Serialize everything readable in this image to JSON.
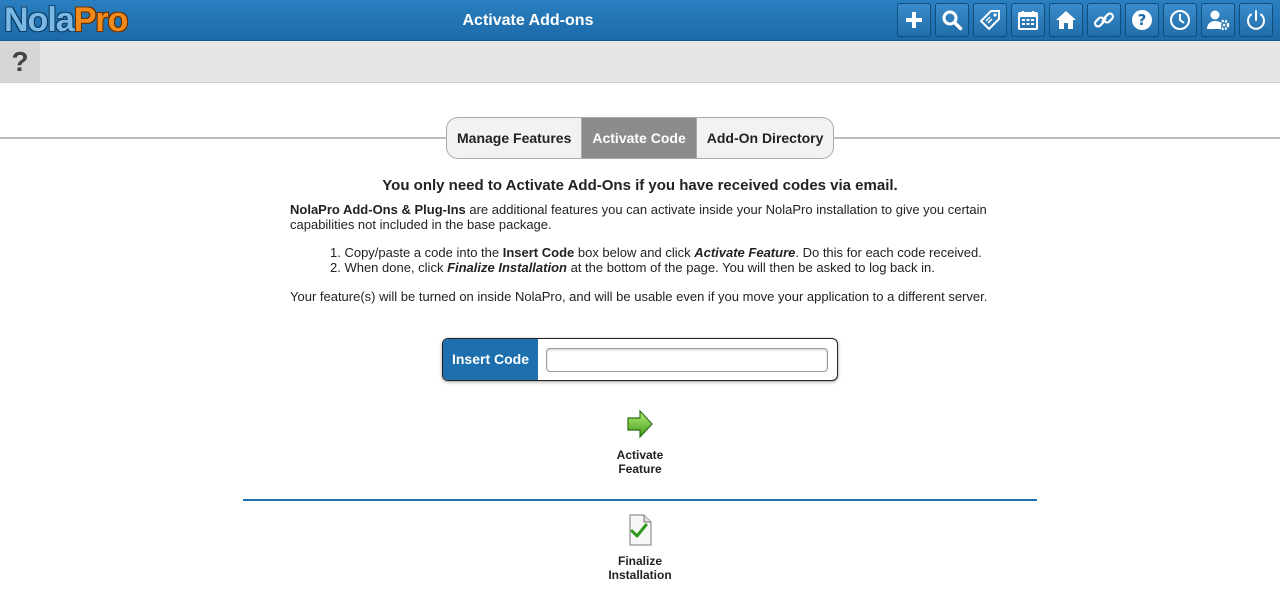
{
  "header": {
    "logo_part1": "Nola",
    "logo_part2": "Pro",
    "title": "Activate Add-ons",
    "icons": [
      "plus-icon",
      "search-icon",
      "tag-icon",
      "calendar-icon",
      "home-icon",
      "link-icon",
      "help-icon",
      "clock-icon",
      "user-settings-icon",
      "power-icon"
    ]
  },
  "subbar": {
    "help_label": "?"
  },
  "tabs": [
    {
      "label": "Manage Features",
      "active": false
    },
    {
      "label": "Activate Code",
      "active": true
    },
    {
      "label": "Add-On Directory",
      "active": false
    }
  ],
  "content": {
    "headline": "You only need to Activate Add-Ons if you have received codes via email.",
    "intro_bold": "NolaPro Add-Ons & Plug-Ins",
    "intro_rest": " are additional features you can activate inside your NolaPro installation to give you certain capabilities not included in the base package.",
    "step1_a": "1. Copy/paste a code into the ",
    "step1_b": "Insert Code",
    "step1_c": " box below and click ",
    "step1_d": "Activate Feature",
    "step1_e": ". Do this for each code received.",
    "step2_a": "2. When done, click ",
    "step2_b": "Finalize Installation",
    "step2_c": " at the bottom of the page. You will then be asked to log back in.",
    "note": "Your feature(s) will be turned on inside NolaPro, and will be usable even if you move your application to a different server."
  },
  "code_field": {
    "label": "Insert Code",
    "value": "",
    "placeholder": ""
  },
  "actions": {
    "activate": {
      "line1": "Activate",
      "line2": "Feature"
    },
    "finalize": {
      "line1": "Finalize",
      "line2": "Installation"
    }
  },
  "colors": {
    "accent": "#1e6fae",
    "active_tab": "#8c8c8c",
    "logo_orange": "#f28a1c"
  }
}
